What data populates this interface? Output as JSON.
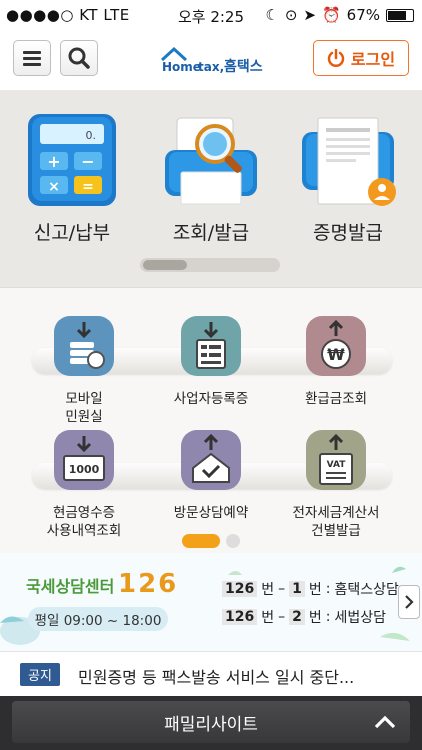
{
  "status_bar": {
    "carrier": "●●●●○ KT  LTE",
    "time": "오후 2:25",
    "battery": "67%"
  },
  "header": {
    "logo_text": "Hometax, 홈택스",
    "login_label": "로그인"
  },
  "main_menu": [
    {
      "label": "신고/납부",
      "icon": "calculator-icon"
    },
    {
      "label": "조회/발급",
      "icon": "magnifier-printer-icon"
    },
    {
      "label": "증명발급",
      "icon": "certificate-printer-icon"
    }
  ],
  "sub_menu": [
    {
      "label": "모바일\n민원실",
      "icon": "mobile-office-icon"
    },
    {
      "label": "사업자등록증",
      "icon": "business-registration-icon"
    },
    {
      "label": "환급금조회",
      "icon": "refund-won-icon"
    },
    {
      "label": "현금영수증\n사용내역조회",
      "icon": "cash-receipt-icon"
    },
    {
      "label": "방문상담예약",
      "icon": "visit-house-icon"
    },
    {
      "label": "전자세금계산서\n건별발급",
      "icon": "vat-invoice-icon"
    }
  ],
  "call_center": {
    "title": "국세상담센터",
    "number": "126",
    "hours": "평일 09:00 ~ 18:00",
    "lines": [
      {
        "main": "126",
        "sub": "1",
        "label": "홈택스상담"
      },
      {
        "main": "126",
        "sub": "2",
        "label": "세법상담"
      }
    ],
    "unit": "번"
  },
  "notice": {
    "badge": "공지",
    "text": "민원증명 등 팩스발송 서비스 일시 중단..."
  },
  "footer": {
    "label": "패밀리사이트"
  },
  "colors": {
    "orange": "#f07d1e",
    "header_bg": "#ffffff",
    "footer_bg": "#2e2e30",
    "notice_badge": "#2f5a92"
  }
}
